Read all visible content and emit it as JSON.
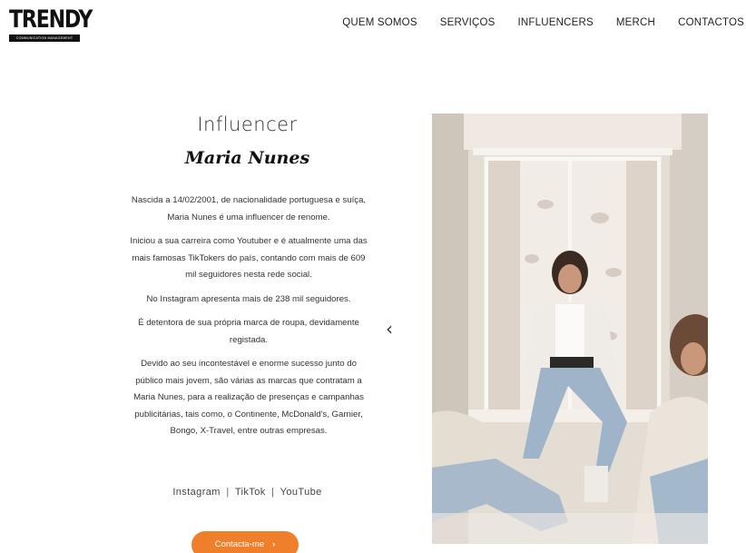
{
  "logo": {
    "wordmark": "TRENDY",
    "tagline": "COMMUNICATION MANAGEMENT"
  },
  "nav": {
    "items": [
      "QUEM SOMOS",
      "SERVIÇOS",
      "INFLUENCERS",
      "MERCH",
      "CONTACTOS"
    ]
  },
  "profile": {
    "heading": "Influencer",
    "name": "Maria Nunes",
    "bio": [
      "Nascida a 14/02/2001, de nacionalidade portuguesa e suíça, Maria Nunes é uma influencer de renome.",
      "Iniciou a sua carreira como Youtuber e é atualmente uma das mais famosas TikTokers do país, contando com mais de 609 mil seguidores nesta rede social.",
      "No Instagram apresenta mais de 238 mil seguidores.",
      "É detentora de sua própria marca de roupa, devidamente registada.",
      "Devido ao seu incontestável e enorme sucesso junto do público mais jovem, são várias as marcas que contratam a Maria Nunes, para a realização de presenças e campanhas publicitárias, tais como, o Continente, McDonald's, Garnier, Bongo, X-Travel, entre outras empresas."
    ],
    "socials": [
      "Instagram",
      "TikTok",
      "YouTube"
    ],
    "separator": "|",
    "cta_label": "Contacta-me",
    "cta_chevron": "›"
  },
  "carousel": {
    "prev_glyph": "‹"
  },
  "colors": {
    "accent": "#f07f2c"
  }
}
